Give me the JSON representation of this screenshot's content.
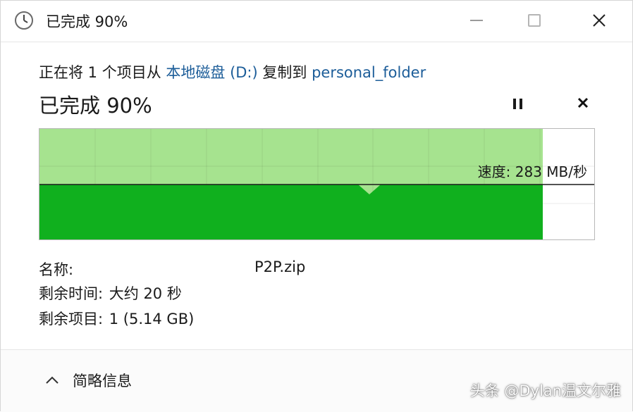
{
  "window": {
    "title": "已完成 90%"
  },
  "copy": {
    "prefix": "正在将 1 个项目从 ",
    "source": "本地磁盘 (D:)",
    "middle": " 复制到 ",
    "destination": "personal_folder"
  },
  "progress": {
    "title": "已完成 90%",
    "percent": 90,
    "speed_label": "速度: 283 MB/秒"
  },
  "details": {
    "name_label": "名称:",
    "name_value": "P2P.zip",
    "time_label": "剩余时间:",
    "time_value": "大约 20 秒",
    "items_label": "剩余项目:",
    "items_value": "1 (5.14 GB)"
  },
  "footer": {
    "toggle_label": "简略信息"
  },
  "watermark": "头条 @Dylan温文尔雅",
  "colors": {
    "graph_light": "#a6e38f",
    "graph_dark": "#10b01e",
    "link": "#1c5d99"
  },
  "icons": {
    "title": "clock-icon",
    "minimize": "minimize-icon",
    "maximize": "maximize-icon",
    "close": "close-icon",
    "pause": "pause-icon",
    "cancel": "cancel-icon",
    "collapse": "chevron-up-icon"
  }
}
